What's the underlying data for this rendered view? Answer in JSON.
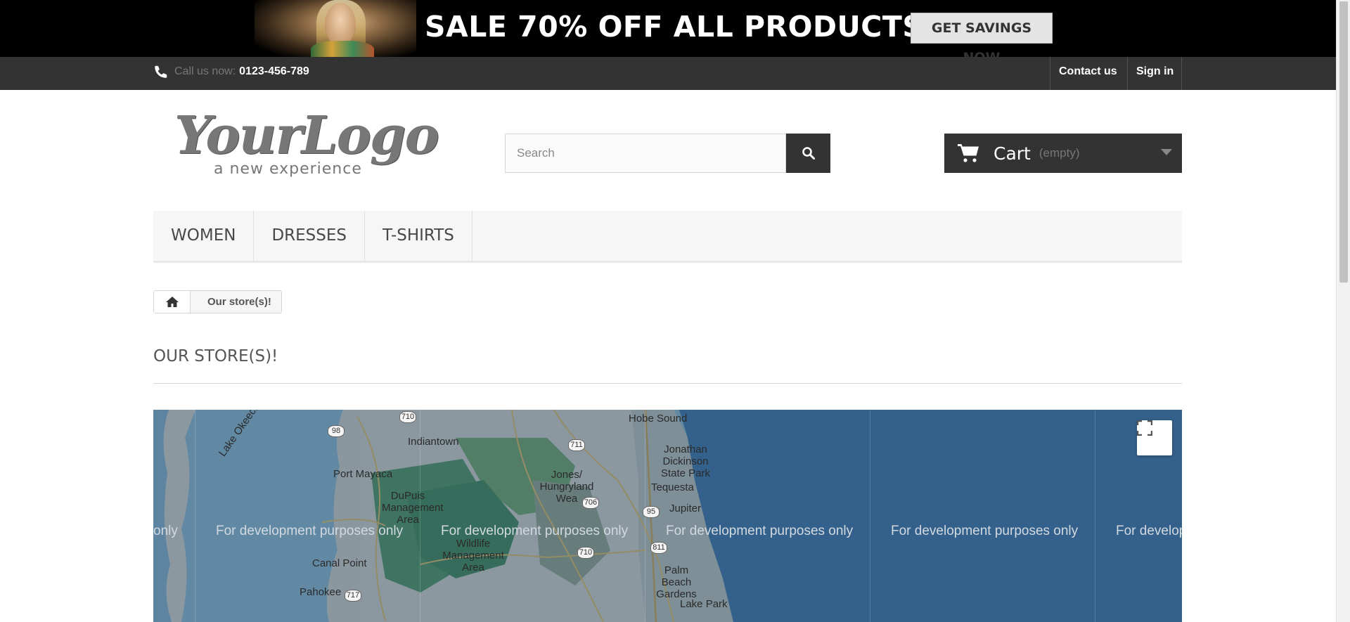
{
  "banner": {
    "text": "SALE 70% OFF ALL PRODUCTS",
    "button": "GET SAVINGS NOW"
  },
  "topbar": {
    "call_label": "Call us now:",
    "phone": "0123-456-789",
    "contact": "Contact us",
    "signin": "Sign in"
  },
  "logo": {
    "script": "YourLogo",
    "tagline": "a new experience"
  },
  "search": {
    "placeholder": "Search"
  },
  "cart": {
    "label": "Cart",
    "status": "(empty)"
  },
  "menu": {
    "items": [
      "WOMEN",
      "DRESSES",
      "T-SHIRTS"
    ]
  },
  "breadcrumb": {
    "current": "Our store(s)!"
  },
  "page": {
    "title": "OUR STORE(S)!"
  },
  "map": {
    "watermark": "For development purposes only",
    "watermark_cut_left": "only",
    "watermark_cut_right": "For develop",
    "places": {
      "hobe_sound": "Hobe Sound",
      "indiantown": "Indiantown",
      "jonathan_dickinson": "Jonathan Dickinson State Park",
      "lake_okeechobee": "Lake Okeechobee",
      "port_mayaca": "Port Mayaca",
      "jones_hungryland": "Jones/ Hungryland Wea",
      "tequesta": "Tequesta",
      "dupuis": "DuPuis Management Area",
      "jupiter": "Jupiter",
      "wildlife": "Wildlife Management Area",
      "canal_point": "Canal Point",
      "palm_beach_gardens": "Palm Beach Gardens",
      "pahokee": "Pahokee",
      "lake_park": "Lake Park"
    },
    "shields": {
      "r710a": "710",
      "r98": "98",
      "r711": "711",
      "r706": "706",
      "r95": "95",
      "r710b": "710",
      "r811": "811",
      "r717": "717"
    }
  },
  "colors": {
    "banner_bg": "#000000",
    "nav_bg": "#333333",
    "map_water": "#2f5678",
    "map_land": "#7b8c6a"
  }
}
